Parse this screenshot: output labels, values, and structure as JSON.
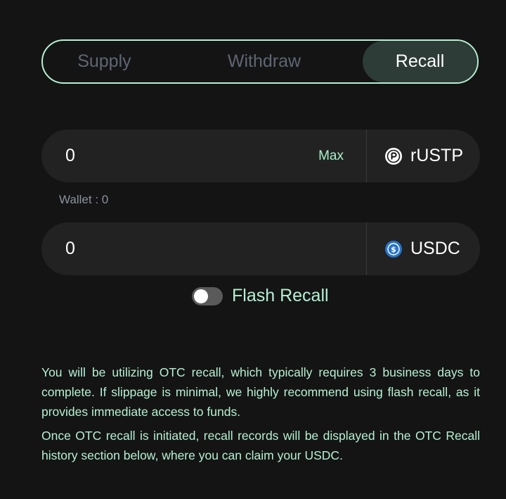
{
  "tabs": {
    "supply": "Supply",
    "withdraw": "Withdraw",
    "recall": "Recall",
    "active": "Recall"
  },
  "from": {
    "amount": "0",
    "max_label": "Max",
    "token": "rUSTP",
    "token_icon": "rustp-token-icon"
  },
  "wallet": {
    "label": "Wallet : 0"
  },
  "to": {
    "amount": "0",
    "token": "USDC",
    "token_icon": "usdc-token-icon"
  },
  "flash_recall": {
    "label": "Flash Recall",
    "enabled": false
  },
  "info": {
    "paragraph1": "You will be utilizing OTC recall, which typically requires 3 business days to complete. If slippage is minimal, we highly recommend using flash recall, as it provides immediate access to funds.",
    "paragraph2": "Once OTC recall is initiated, recall records will be displayed in the OTC Recall history section below, where you can claim your USDC."
  },
  "colors": {
    "background": "#141414",
    "accent": "#b6f0d4",
    "active_tab_bg": "#2d3c36",
    "input_bg": "#222222",
    "usdc_blue": "#2775ca"
  }
}
